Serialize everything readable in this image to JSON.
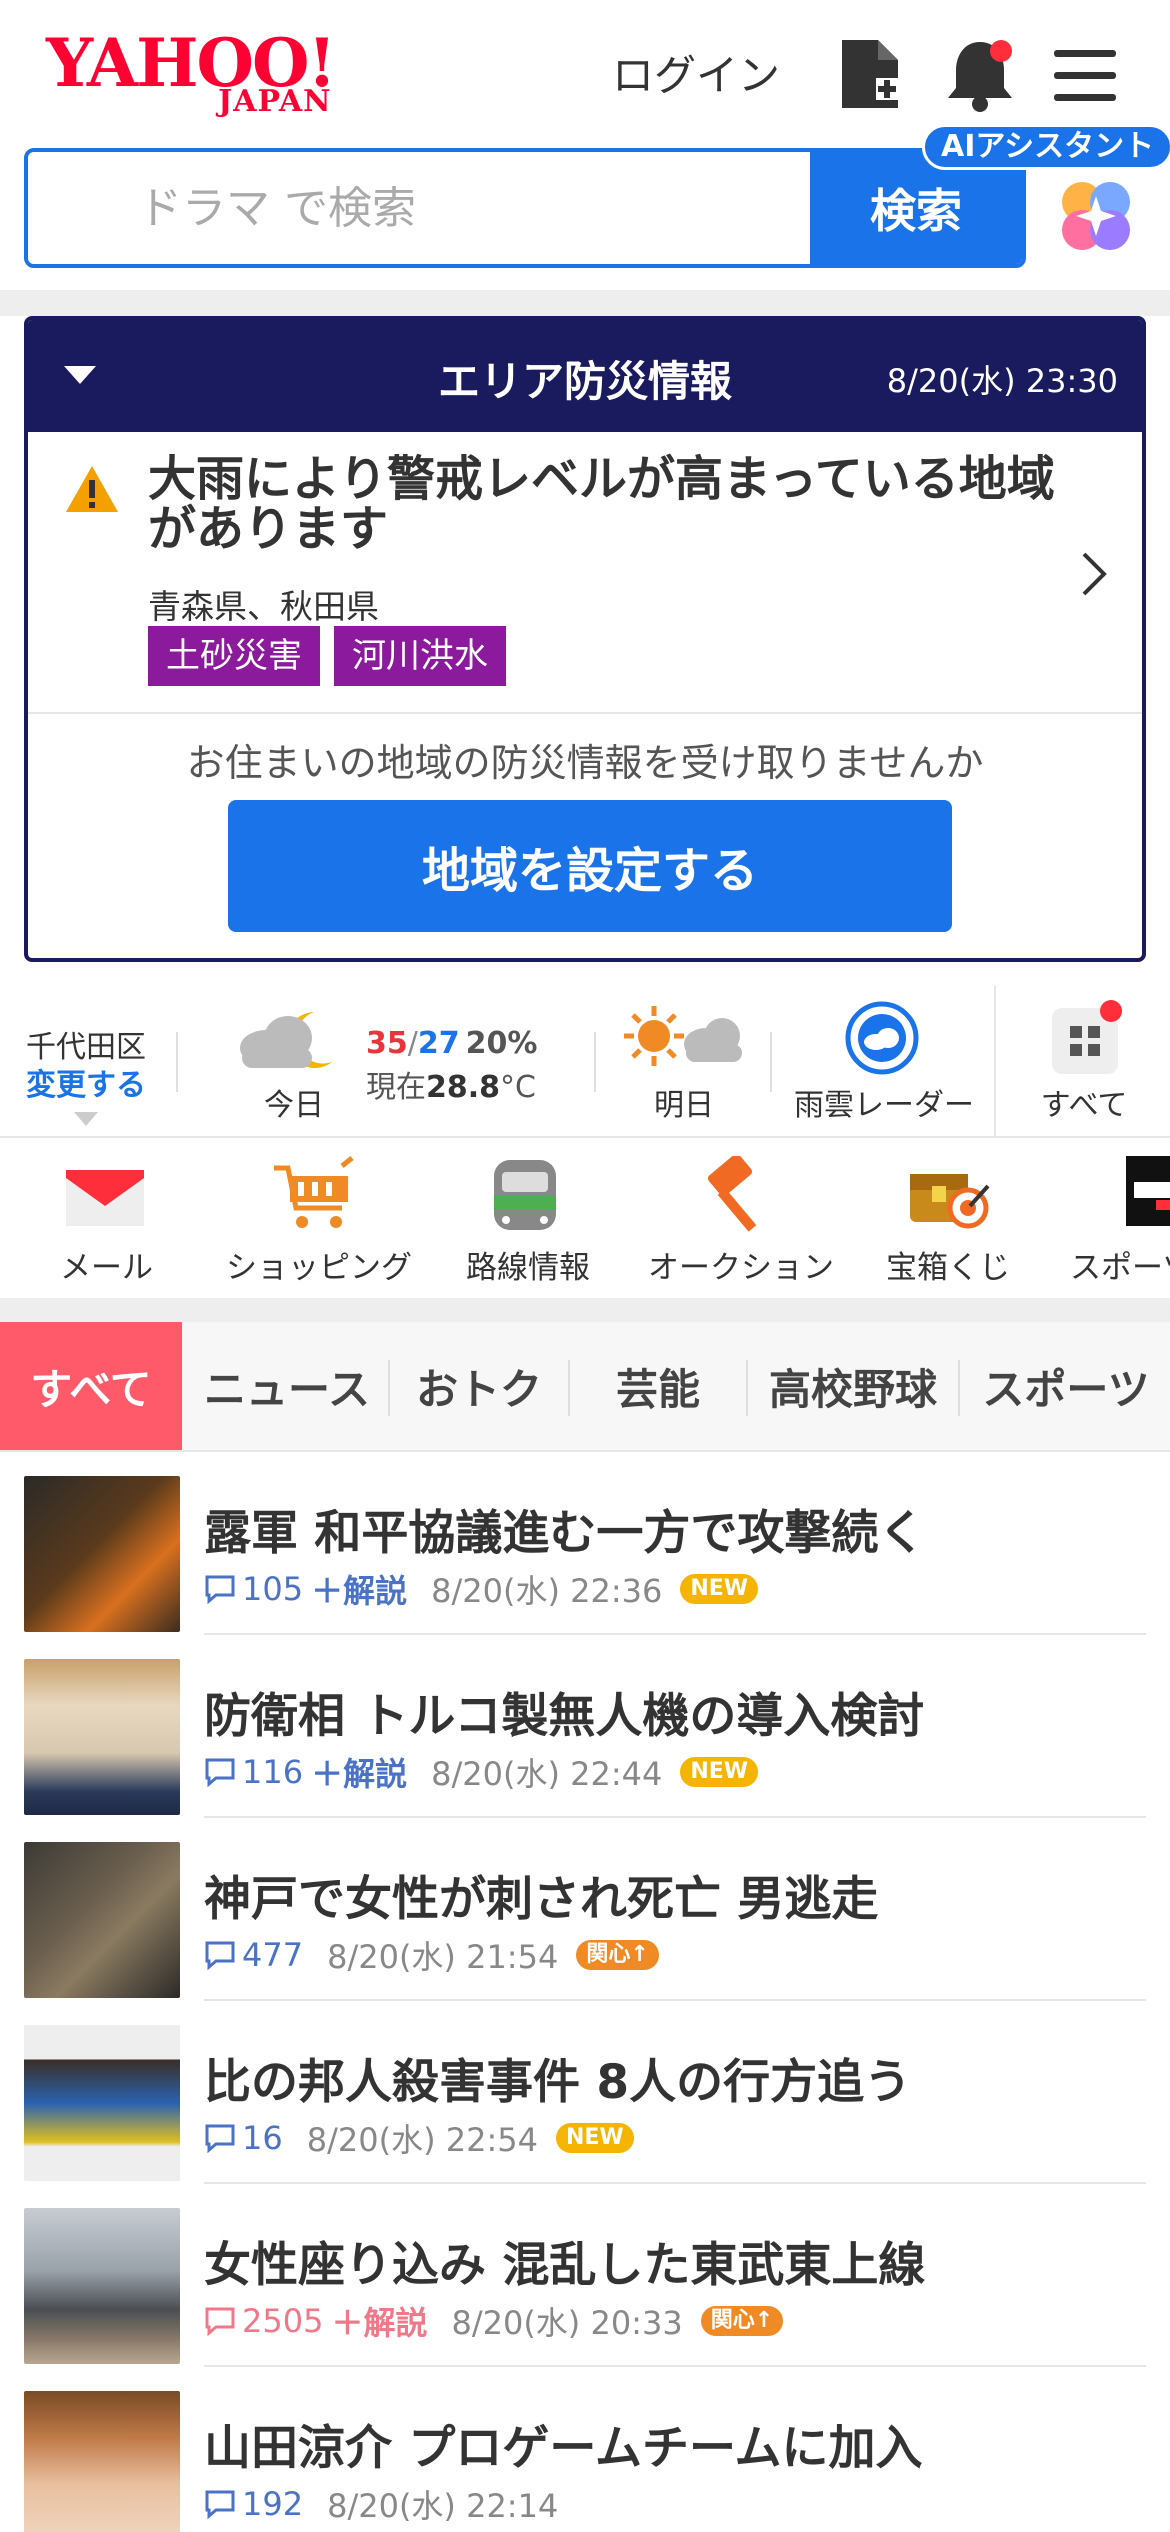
{
  "header": {
    "logo_text": "YAHOO!",
    "logo_sub": "JAPAN",
    "login_label": "ログイン"
  },
  "search": {
    "placeholder": "ドラマ で検索",
    "button_label": "検索",
    "ai_label": "AIアシスタント"
  },
  "disaster": {
    "title": "エリア防災情報",
    "datetime": "8/20(水) 23:30",
    "alert": "大雨により警戒レベルが高まっている地域があります",
    "regions": "青森県、秋田県",
    "tags": [
      "土砂災害",
      "河川洪水"
    ],
    "question": "お住まいの地域の防災情報を受け取りませんか",
    "cta_label": "地域を設定する",
    "tag_color": "#8c1a9c"
  },
  "weather": {
    "location": "千代田区",
    "change_label": "変更する",
    "today_label": "今日",
    "high": "35",
    "low": "27",
    "pop": "20%",
    "now_prefix": "現在",
    "now_temp": "28.8",
    "now_unit": "°C",
    "tomorrow_label": "明日",
    "radar_label": "雨雲レーダー",
    "all_label": "すべて"
  },
  "services": [
    {
      "label": "メール",
      "icon": "mail-icon"
    },
    {
      "label": "ショッピング",
      "icon": "cart-icon"
    },
    {
      "label": "路線情報",
      "icon": "train-icon"
    },
    {
      "label": "オークション",
      "icon": "gavel-icon"
    },
    {
      "label": "宝箱くじ",
      "icon": "treasure-icon"
    },
    {
      "label": "スポーツ",
      "icon": "sports-icon"
    }
  ],
  "tabs": [
    "すべて",
    "ニュース",
    "おトク",
    "芸能",
    "高校野球",
    "スポーツ"
  ],
  "news": [
    {
      "title": "露軍 和平協議進む一方で攻撃続く",
      "comments": "105",
      "plus": "＋解説",
      "time": "8/20(水) 22:36",
      "badge": "NEW"
    },
    {
      "title": "防衛相 トルコ製無人機の導入検討",
      "comments": "116",
      "plus": "＋解説",
      "time": "8/20(水) 22:44",
      "badge": "NEW"
    },
    {
      "title": "神戸で女性が刺され死亡 男逃走",
      "comments": "477",
      "plus": "",
      "time": "8/20(水) 21:54",
      "badge": "関心↑"
    },
    {
      "title": "比の邦人殺害事件 8人の行方追う",
      "comments": "16",
      "plus": "",
      "time": "8/20(水) 22:54",
      "badge": "NEW"
    },
    {
      "title": "女性座り込み 混乱した東武東上線",
      "comments": "2505",
      "plus": "＋解説",
      "time": "8/20(水) 20:33",
      "badge": "関心↑"
    },
    {
      "title": "山田涼介 プロゲームチームに加入",
      "comments": "192",
      "plus": "",
      "time": "8/20(水) 22:14",
      "badge": ""
    }
  ],
  "colors": {
    "brand_red": "#ff0033",
    "accent_blue": "#1a73e8",
    "navy": "#1a1a5e",
    "tab_active": "#ff5a6a"
  }
}
